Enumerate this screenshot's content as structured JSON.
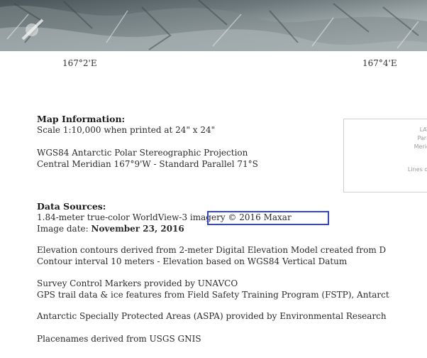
{
  "map": {
    "imagery_alt": "satellite imagery strip",
    "ticks": [
      "167°2'E",
      "167°4'E"
    ]
  },
  "map_info": {
    "heading": "Map Information:",
    "lines": [
      "Scale 1:10,000 when printed at 24\" x 24\"",
      "WGS84 Antarctic Polar Stereographic Projection",
      "Central Meridian 167°9'W - Standard Parallel 71°S"
    ]
  },
  "legend": {
    "lines": [
      "LAT",
      "Para",
      "Merid",
      "Lines of"
    ]
  },
  "data_sources": {
    "heading": "Data Sources:",
    "imagery_prefix": "1.84-meter true-color WorldView-3",
    "imagery_highlight": "imagery © 2016 Maxar",
    "image_date_label": "Image date: ",
    "image_date_value": "November 23, 2016",
    "paragraphs": [
      "Elevation contours derived from 2-meter Digital Elevation Model created from D",
      "Contour interval 10 meters - Elevation based on WGS84 Vertical Datum",
      "Survey Control Markers provided by UNAVCO",
      "GPS trail data & ice features from Field Safety Training Program (FSTP), Antarct",
      "Antarctic Specially Protected Areas (ASPA) provided by Environmental Research",
      "Placenames derived from USGS GNIS"
    ]
  },
  "colors": {
    "highlight_border": "#3345d8"
  }
}
